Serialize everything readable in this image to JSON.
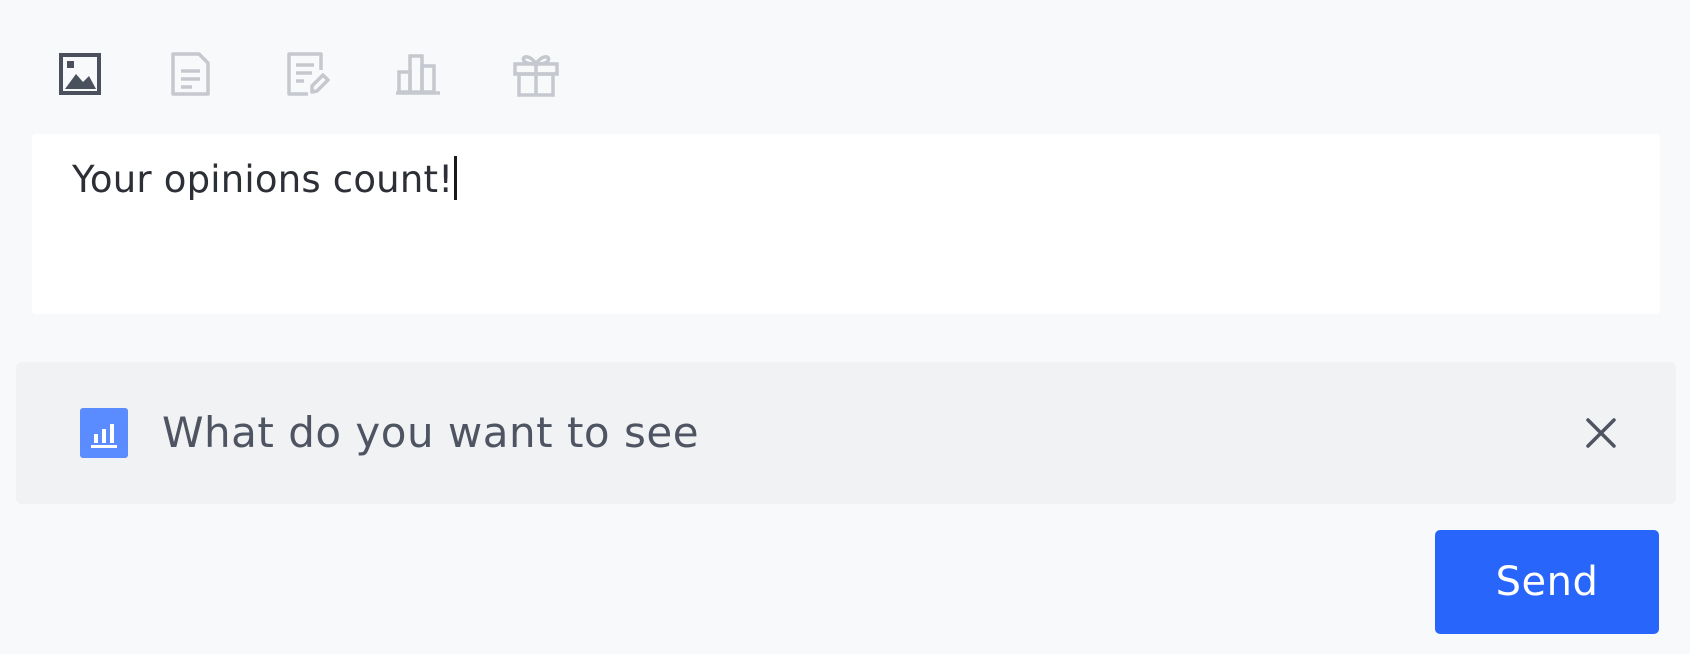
{
  "toolbar": {
    "tools": [
      {
        "icon": "image-icon",
        "active": true
      },
      {
        "icon": "document-icon",
        "active": false
      },
      {
        "icon": "edit-note-icon",
        "active": false
      },
      {
        "icon": "bar-chart-icon",
        "active": false
      },
      {
        "icon": "gift-icon",
        "active": false
      }
    ],
    "active_color": "#4a505c",
    "inactive_color": "#c5c8ce"
  },
  "composer": {
    "value": "Your opinions count!"
  },
  "poll": {
    "icon": "poll-chart-icon",
    "icon_color": "#5b8cff",
    "label": "What do you want to see",
    "close_icon": "close-icon"
  },
  "send": {
    "label": "Send",
    "color": "#2865fa"
  }
}
